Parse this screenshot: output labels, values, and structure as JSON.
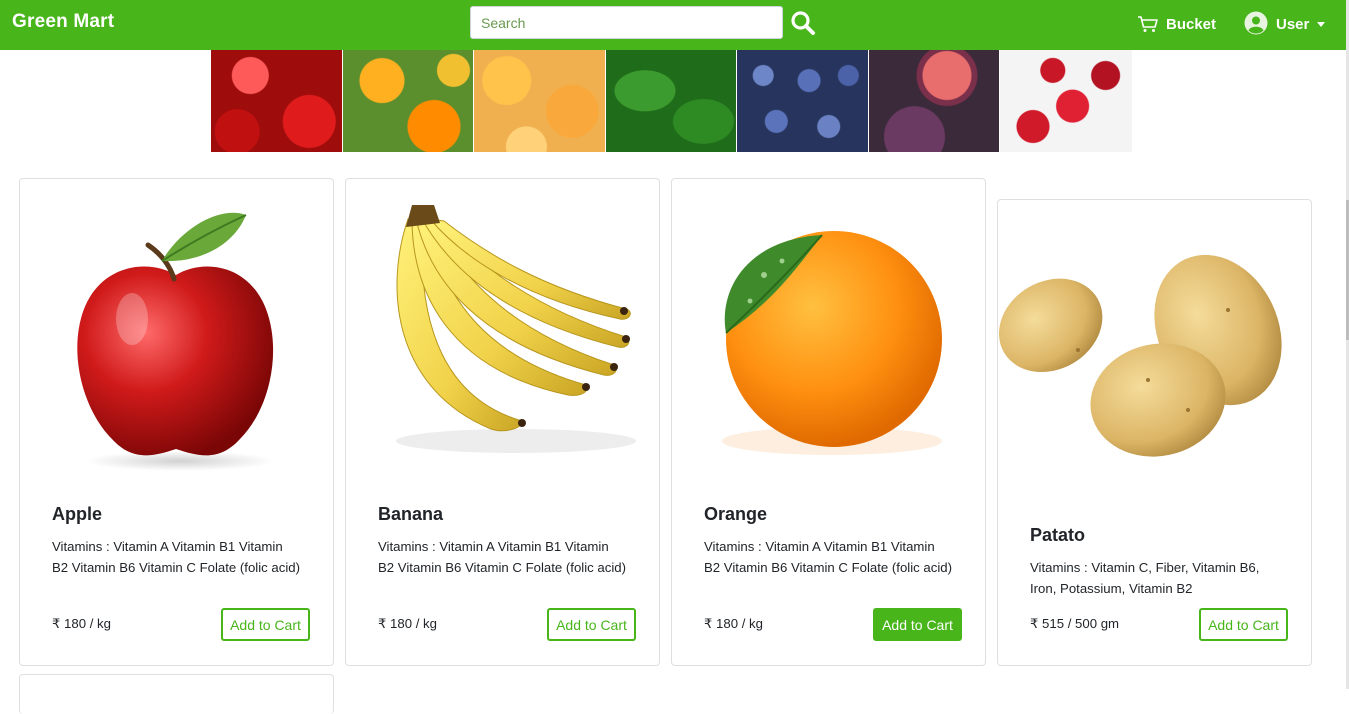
{
  "navbar": {
    "brand": "Green Mart",
    "search_placeholder": "Search",
    "bucket_label": "Bucket",
    "user_label": "User"
  },
  "colors": {
    "brand_green": "#48b51a",
    "text": "#212529"
  },
  "banner": {
    "tiles": [
      "strawberries",
      "oranges",
      "apricots",
      "leafy-greens",
      "blueberries",
      "figs",
      "cherries"
    ]
  },
  "products": [
    {
      "name": "Apple",
      "vitamins": "Vitamins : Vitamin A Vitamin B1 Vitamin B2 Vitamin B6 Vitamin C Folate (folic acid)",
      "price": "₹ 180 / kg",
      "button": "Add to Cart"
    },
    {
      "name": "Banana",
      "vitamins": "Vitamins : Vitamin A Vitamin B1 Vitamin B2 Vitamin B6 Vitamin C Folate (folic acid)",
      "price": "₹ 180 / kg",
      "button": "Add to Cart"
    },
    {
      "name": "Orange",
      "vitamins": "Vitamins : Vitamin A Vitamin B1 Vitamin B2 Vitamin B6 Vitamin C Folate (folic acid)",
      "price": "₹ 180 / kg",
      "button": "Add to Cart"
    },
    {
      "name": "Patato",
      "vitamins": "Vitamins : Vitamin C, Fiber, Vitamin B6, Iron, Potassium, Vitamin B2",
      "price": "₹ 515 / 500 gm",
      "button": "Add to Cart"
    }
  ]
}
